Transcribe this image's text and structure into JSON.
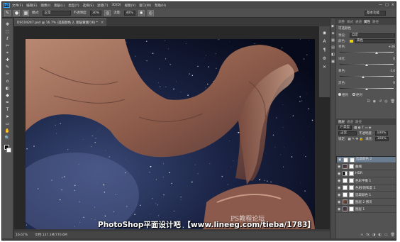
{
  "menubar": {
    "logo": "Ps",
    "items": [
      "文件(F)",
      "编辑(E)",
      "图像(I)",
      "图层(L)",
      "类型(Y)",
      "选择(S)",
      "滤镜(T)",
      "3D(D)",
      "视图(V)",
      "窗口(W)",
      "帮助(H)"
    ],
    "window_controls": [
      "—",
      "□",
      "×"
    ]
  },
  "optbar": {
    "tool_icon": "✎",
    "mode_label": "模式:",
    "mode_value": "正常",
    "opacity_label": "不透明度:",
    "opacity_value": "30%",
    "flow_label": "流量:",
    "flow_value": "40%",
    "workspace": "基本功能"
  },
  "document": {
    "tab_title": "DSC04247.psd @ 16.7% (选取颜色 2, 图层蒙版/16) *",
    "close": "×"
  },
  "statusbar": {
    "zoom": "16.67%",
    "doc_size": "文档:137.1M/770.6M"
  },
  "toolbar_icons": [
    "✥",
    "⬚",
    "ℓ",
    "✂",
    "⌖",
    "✚",
    "✎",
    "✑",
    "⌂",
    "◐",
    "◆",
    "✒",
    "T",
    "➤",
    "▭",
    "✋",
    "🔍"
  ],
  "mid_strip_icons": [
    "◉",
    "A",
    "¶",
    "⚙",
    "✕"
  ],
  "right_strip_icons": [
    "▶",
    "◈",
    "▦",
    "▤",
    "◧",
    "▣"
  ],
  "panel_tabs": [
    "调整",
    "样式",
    "通道",
    "属性",
    "路径"
  ],
  "properties": {
    "title": "可选颜色",
    "preset_label": "预设:",
    "preset_value": "自定",
    "colors_label": "颜色:",
    "colors_value": "黄色",
    "sliders": [
      {
        "label": "青色:",
        "value": "+36",
        "pct": 0.68
      },
      {
        "label": "洋红:",
        "value": "0",
        "pct": 0.5
      },
      {
        "label": "黄色:",
        "value": "-14",
        "pct": 0.43
      },
      {
        "label": "黑色:",
        "value": "0",
        "pct": 0.5
      }
    ],
    "radio_relative": "相对",
    "radio_absolute": "绝对"
  },
  "layers": {
    "tabs": [
      "图层",
      "通道",
      "路径"
    ],
    "kind_label": "P 类型",
    "blend_mode": "正常",
    "opacity_label": "不透明度:",
    "opacity_value": "100%",
    "lock_label": "锁定:",
    "fill_label": "填充:",
    "fill_value": "100%",
    "items": [
      {
        "name": "选取颜色 2",
        "thumb": "white",
        "selected": true
      },
      {
        "name": "曲线",
        "thumb": "dark",
        "selected": false
      },
      {
        "name": "HDR",
        "thumb": "bw",
        "selected": false
      },
      {
        "name": "色彩平衡 1",
        "thumb": "white",
        "selected": false
      },
      {
        "name": "色相/饱和度 1",
        "thumb": "white",
        "selected": false
      },
      {
        "name": "选取颜色 1",
        "thumb": "white",
        "selected": false
      },
      {
        "name": "图层 2 拷贝",
        "thumb": "rock",
        "selected": false
      },
      {
        "name": "图层 1",
        "thumb": "dark",
        "selected": false
      }
    ],
    "footer_icons": [
      "∞",
      "fx",
      "◑",
      "◐",
      "▭",
      "🗑"
    ]
  },
  "watermark": {
    "text": "PhotoShop平面设计吧 【www.lineeg.com/tieba/1783】",
    "small": "PS教程论坛"
  }
}
